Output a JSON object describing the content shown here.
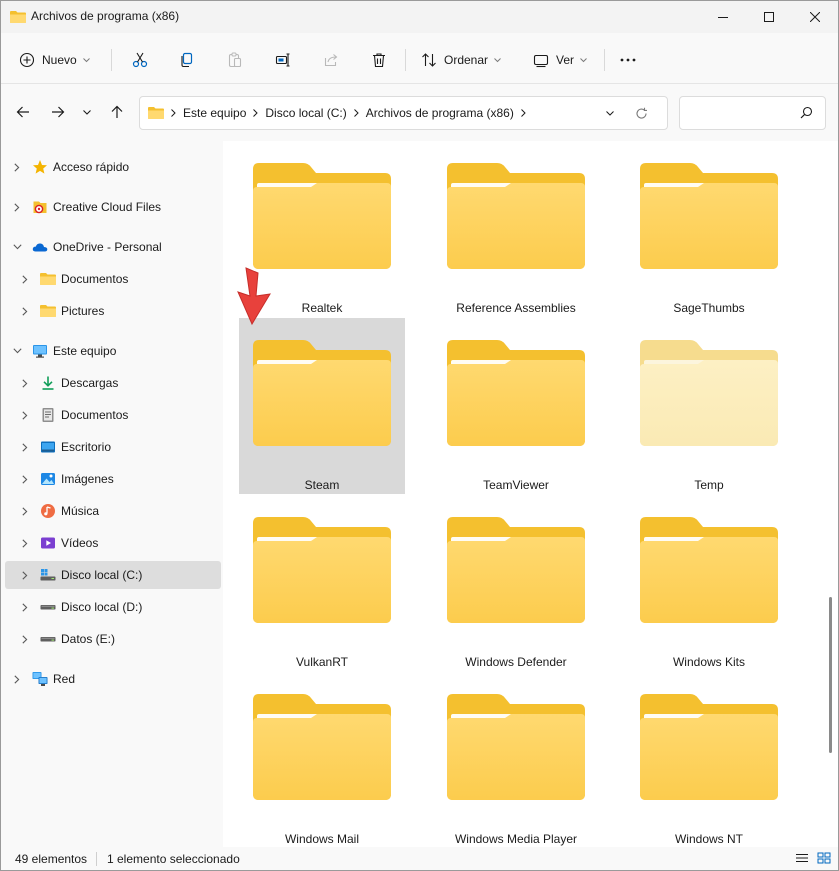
{
  "window": {
    "title": "Archivos de programa (x86)"
  },
  "toolbar": {
    "new_label": "Nuevo",
    "sort_label": "Ordenar",
    "view_label": "Ver"
  },
  "address": {
    "crumbs": [
      "Este equipo",
      "Disco local (C:)",
      "Archivos de programa (x86)"
    ]
  },
  "sidebar": {
    "items": [
      {
        "label": "Acceso rápido",
        "icon": "star-icon",
        "level": 0,
        "expanded": false
      },
      {
        "label": "Creative Cloud Files",
        "icon": "creative-cloud-icon",
        "level": 0,
        "expanded": false
      },
      {
        "label": "OneDrive - Personal",
        "icon": "onedrive-cloud-icon",
        "level": 0,
        "expanded": true
      },
      {
        "label": "Documentos",
        "icon": "folder-icon",
        "level": 1,
        "expanded": false
      },
      {
        "label": "Pictures",
        "icon": "folder-icon",
        "level": 1,
        "expanded": false
      },
      {
        "label": "Este equipo",
        "icon": "computer-icon",
        "level": 0,
        "expanded": true
      },
      {
        "label": "Descargas",
        "icon": "download-icon",
        "level": 1,
        "expanded": false
      },
      {
        "label": "Documentos",
        "icon": "document-icon",
        "level": 1,
        "expanded": false
      },
      {
        "label": "Escritorio",
        "icon": "desktop-icon",
        "level": 1,
        "expanded": false
      },
      {
        "label": "Imágenes",
        "icon": "pictures-icon",
        "level": 1,
        "expanded": false
      },
      {
        "label": "Música",
        "icon": "music-icon",
        "level": 1,
        "expanded": false
      },
      {
        "label": "Vídeos",
        "icon": "videos-icon",
        "level": 1,
        "expanded": false
      },
      {
        "label": "Disco local (C:)",
        "icon": "drive-c-icon",
        "level": 1,
        "expanded": false,
        "selected": true
      },
      {
        "label": "Disco local (D:)",
        "icon": "drive-icon",
        "level": 1,
        "expanded": false
      },
      {
        "label": "Datos (E:)",
        "icon": "drive-icon",
        "level": 1,
        "expanded": false
      },
      {
        "label": "Red",
        "icon": "network-icon",
        "level": 0,
        "expanded": false
      }
    ]
  },
  "content": {
    "folders": [
      {
        "name": "Realtek"
      },
      {
        "name": "Reference Assemblies"
      },
      {
        "name": "SageThumbs"
      },
      {
        "name": "Steam",
        "selected": true
      },
      {
        "name": "TeamViewer"
      },
      {
        "name": "Temp",
        "faded": true
      },
      {
        "name": "VulkanRT"
      },
      {
        "name": "Windows Defender"
      },
      {
        "name": "Windows Kits"
      },
      {
        "name": "Windows Mail"
      },
      {
        "name": "Windows Media Player"
      },
      {
        "name": "Windows NT"
      }
    ]
  },
  "status": {
    "count": "49 elementos",
    "selection": "1 elemento seleccionado"
  },
  "colors": {
    "folder_back": "#f4c02f",
    "folder_front": "#ffd970",
    "selection": "#d9d9d9",
    "accent": "#0067c0",
    "annotation_arrow": "#e8413c"
  }
}
